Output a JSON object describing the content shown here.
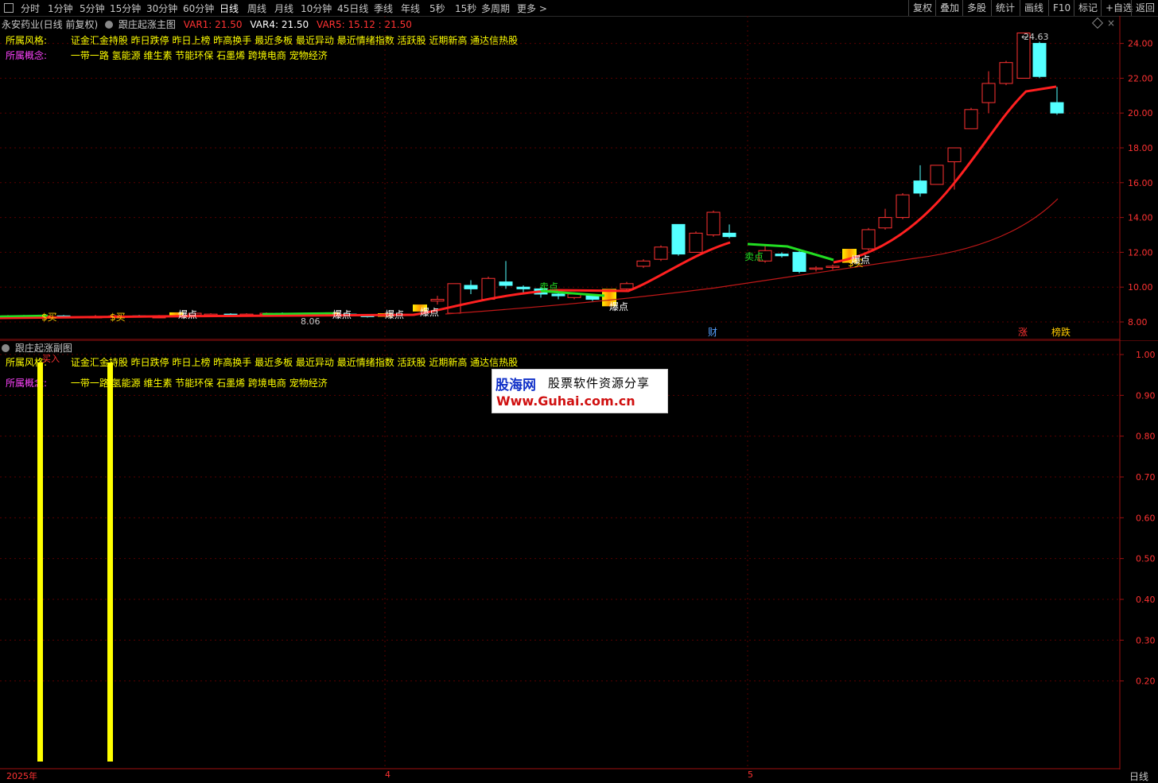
{
  "toolbar": {
    "periods": [
      "分时",
      "1分钟",
      "5分钟",
      "15分钟",
      "30分钟",
      "60分钟",
      "日线",
      "周线",
      "月线",
      "10分钟",
      "45日线",
      "季线",
      "年线",
      "5秒",
      "15秒",
      "多周期",
      "更多 >"
    ],
    "active_period": "日线",
    "right_buttons": [
      "复权",
      "叠加",
      "多股",
      "统计",
      "画线",
      "F10",
      "标记",
      "+自选",
      "返回"
    ]
  },
  "main_panel": {
    "stock_name": "永安药业(日线 前复权)",
    "indicator_name": "跟庄起涨主图",
    "var1": "VAR1: 21.50",
    "var4": "VAR4: 21.50",
    "var5": "VAR5: 15.12 : 21.50",
    "style_label": "所属风格:",
    "style_value": "证金汇金持股 昨日跌停 昨日上榜 昨高换手 最近多板 最近异动 最近情绪指数 活跃股 近期新高 通达信热股",
    "concept_label": "所属概念:",
    "concept_value": "一带一路 氢能源 维生素 节能环保 石墨烯 跨境电商 宠物经济",
    "y_ticks": [
      "24.00",
      "22.00",
      "20.00",
      "18.00",
      "16.00",
      "14.00",
      "12.00",
      "10.00",
      "8.00"
    ],
    "high_label": "24.63",
    "low_label": "8.06",
    "annotations": [
      "$买",
      "$买",
      "爆点",
      "爆点",
      "爆点",
      "爆点",
      "卖点",
      "爆点",
      "卖点",
      "$买",
      "爆点"
    ],
    "bottom_markers": [
      "财",
      "涨",
      "榜跌"
    ]
  },
  "sub_panel": {
    "indicator_name": "跟庄起涨副图",
    "buy_label": "买入",
    "style_label": "所属风格:",
    "style_value": "证金汇金持股 昨日跌停 昨日上榜 昨高换手 最近多板 最近异动 最近情绪指数 活跃股 近期新高 通达信热股",
    "concept_label": "所属概念:",
    "concept_value": "一带一路 氢能源 维生素 节能环保 石墨烯 跨境电商 宠物经济",
    "y_ticks": [
      "1.00",
      "0.90",
      "0.80",
      "0.70",
      "0.60",
      "0.50",
      "0.40",
      "0.30",
      "0.20"
    ]
  },
  "watermark": {
    "brand": "股海网",
    "slogan": "股票软件资源分享",
    "url": "Www.Guhai.com.cn"
  },
  "x_axis": {
    "labels": [
      "2025年",
      "4",
      "5"
    ],
    "period": "日线"
  },
  "colors": {
    "up": "#ff3232",
    "down": "#54ffff",
    "accent_red": "#ff2020",
    "yellow": "#ffff00",
    "green": "#22dd22"
  }
}
